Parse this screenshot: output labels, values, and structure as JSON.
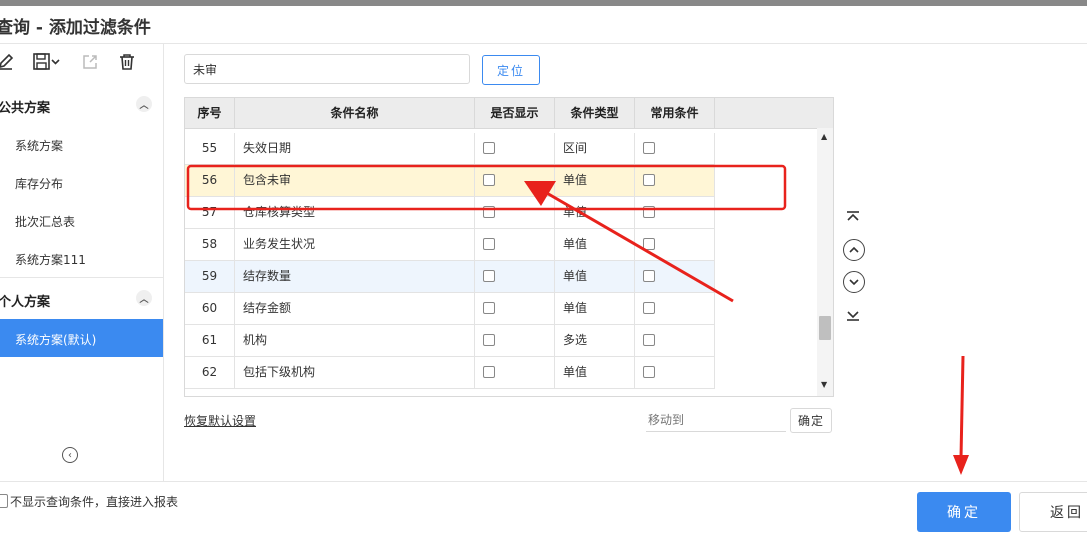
{
  "window": {
    "title": "查询 - 添加过滤条件"
  },
  "toolbar": {
    "icons": [
      "edit-icon",
      "save-icon",
      "export-icon",
      "delete-icon"
    ]
  },
  "sidebar": {
    "public_section": {
      "label": "公共方案",
      "items": [
        "系统方案",
        "库存分布",
        "批次汇总表",
        "系统方案111"
      ]
    },
    "personal_section": {
      "label": "个人方案",
      "items": [
        "系统方案(默认)"
      ]
    }
  },
  "search": {
    "value": "未审"
  },
  "locate_button": "定位",
  "table": {
    "columns": [
      "序号",
      "条件名称",
      "是否显示",
      "条件类型",
      "常用条件"
    ],
    "rows": [
      {
        "num": "55",
        "name": "失效日期",
        "type": "区间"
      },
      {
        "num": "56",
        "name": "包含未审",
        "type": "单值"
      },
      {
        "num": "57",
        "name": "仓库核算类型",
        "type": "单值"
      },
      {
        "num": "58",
        "name": "业务发生状况",
        "type": "单值"
      },
      {
        "num": "59",
        "name": "结存数量",
        "type": "单值"
      },
      {
        "num": "60",
        "name": "结存金额",
        "type": "单值"
      },
      {
        "num": "61",
        "name": "机构",
        "type": "多选"
      },
      {
        "num": "62",
        "name": "包括下级机构",
        "type": "单值"
      }
    ]
  },
  "reset_link": "恢复默认设置",
  "move_to": {
    "placeholder": "移动到",
    "button": "确定"
  },
  "footer": {
    "skip_label": "不显示查询条件，直接进入报表",
    "ok": "确定",
    "back": "返回"
  },
  "colors": {
    "accent": "#3b8af0",
    "annotation": "#e8221c",
    "highlight": "#fff6d6"
  }
}
